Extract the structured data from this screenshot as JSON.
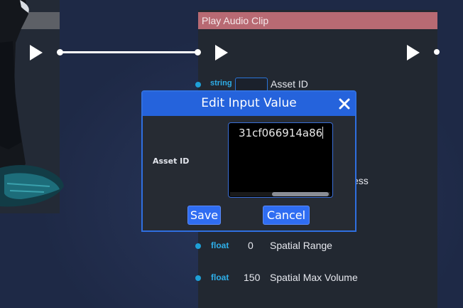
{
  "node": {
    "title": "Play Audio Clip"
  },
  "params": [
    {
      "type": "string",
      "value": "",
      "name": "Asset ID"
    },
    {
      "type": "float",
      "value": "0",
      "name": "Spatial Range"
    },
    {
      "type": "float",
      "value": "150",
      "name": "Spatial Max Volume"
    }
  ],
  "partially_hidden_param": {
    "name_fragment": "ess"
  },
  "modal": {
    "title": "Edit Input Value",
    "field_label": "Asset ID",
    "field_value": "31cf066914a86",
    "save_label": "Save",
    "cancel_label": "Cancel"
  },
  "colors": {
    "node_header": "#b86a73",
    "modal_header": "#2563dc",
    "port": "#1ea0d8",
    "type_text": "#2eaee8",
    "button": "#2f6df2"
  },
  "icons": [
    "play-icon",
    "close-icon"
  ]
}
